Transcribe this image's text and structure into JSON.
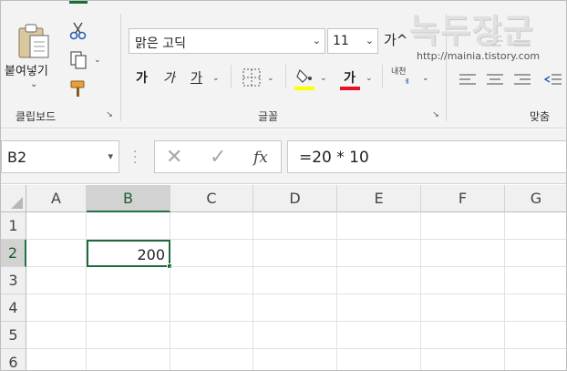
{
  "ribbon": {
    "clipboard": {
      "paste_label": "붙여넣기",
      "group_label": "클립보드"
    },
    "font": {
      "font_name": "맑은 고딕",
      "font_size": "11",
      "grow_label": "가^",
      "bold_label": "가",
      "italic_label": "가",
      "underline_label": "가",
      "fill_color": "#ffff00",
      "font_color_label": "가",
      "font_color": "#e81123",
      "phonetic_label": "내천",
      "group_label": "글꼴"
    },
    "align": {
      "group_label": "맞춤"
    },
    "watermark": {
      "title": "녹두장군",
      "url": "http://mainia.tistory.com"
    }
  },
  "formula_bar": {
    "name_box": "B2",
    "cancel_icon": "✕",
    "enter_icon": "✓",
    "fx_label": "fx",
    "formula": "=20 * 10"
  },
  "sheet": {
    "columns": [
      "A",
      "B",
      "C",
      "D",
      "E",
      "F",
      "G"
    ],
    "rows": [
      "1",
      "2",
      "3",
      "4",
      "5",
      "6"
    ],
    "selected_cell": "B2",
    "cells": {
      "B2": "200"
    }
  },
  "colors": {
    "accent": "#217346",
    "ribbon_bg": "#f3f3f3"
  }
}
